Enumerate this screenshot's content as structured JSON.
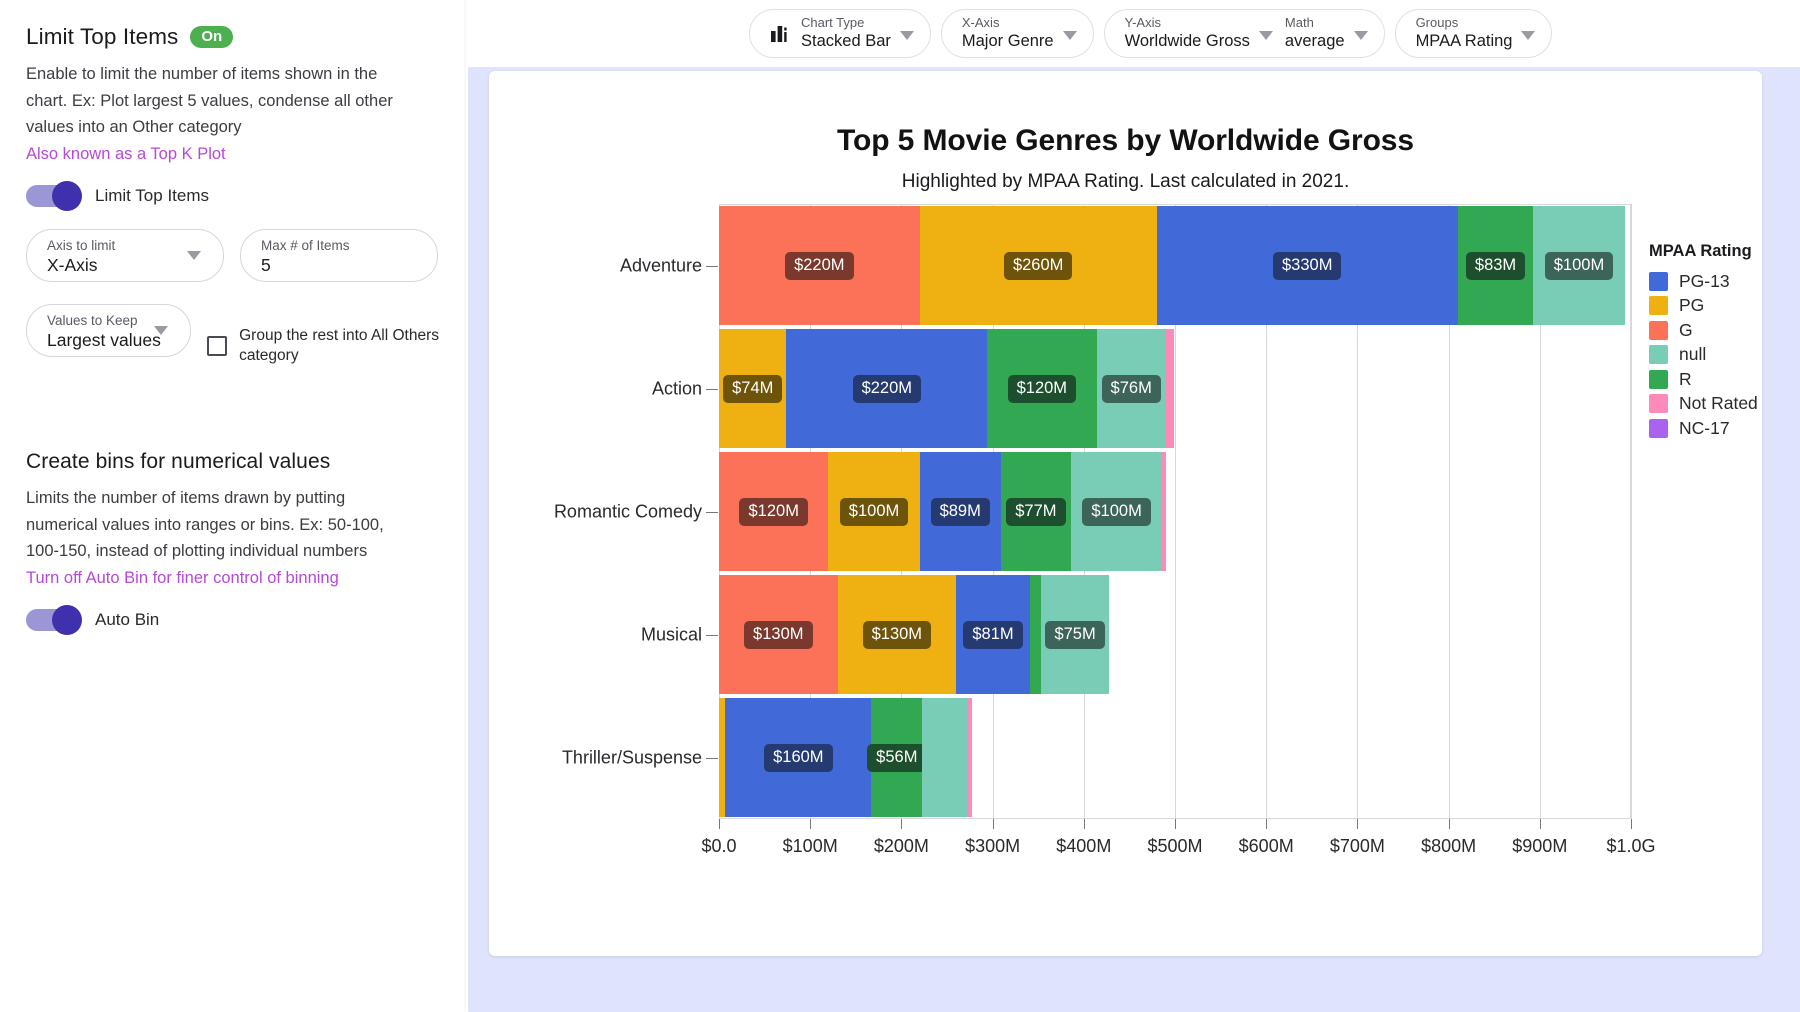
{
  "left_panel": {
    "section1": {
      "title": "Limit Top Items",
      "badge": "On",
      "description": "Enable to limit the number of items shown in the chart. Ex: Plot largest 5 values, condense all other values into an Other category",
      "link": "Also known as a Top K Plot",
      "toggle_label": "Limit Top Items",
      "fields": [
        {
          "label": "Axis to limit",
          "value": "X-Axis",
          "type": "select"
        },
        {
          "label": "Max # of Items",
          "value": "5",
          "type": "input"
        },
        {
          "label": "Values to Keep",
          "value": "Largest values",
          "type": "select"
        }
      ],
      "checkbox_label": "Group the rest into All Others category"
    },
    "section2": {
      "title": "Create bins for numerical values",
      "description": "Limits the number of items drawn by putting numerical values into ranges or bins. Ex: 50-100, 100-150, instead of plotting individual numbers",
      "link": "Turn off Auto Bin for finer control of binning",
      "toggle_label": "Auto Bin"
    }
  },
  "toolbar": {
    "controls": [
      {
        "label": "Chart Type",
        "value": "Stacked Bar",
        "icon": "bar-chart-icon"
      },
      {
        "label": "X-Axis",
        "value": "Major Genre"
      },
      {
        "label": "Y-Axis",
        "value": "Worldwide Gross"
      },
      {
        "label": "Math",
        "value": "average"
      },
      {
        "label": "Groups",
        "value": "MPAA Rating"
      }
    ]
  },
  "chart_data": {
    "type": "bar",
    "orientation": "horizontal",
    "stacked": true,
    "title": "Top 5 Movie Genres by Worldwide Gross",
    "subtitle": "Highlighted by MPAA Rating. Last calculated in 2021.",
    "xlabel": "",
    "ylabel": "",
    "grid": true,
    "legend_position": "right",
    "legend_title": "MPAA Rating",
    "xlim": [
      0,
      1000
    ],
    "xticks": [
      0,
      100,
      200,
      300,
      400,
      500,
      600,
      700,
      800,
      900,
      1000
    ],
    "xticklabels": [
      "$0.0",
      "$100M",
      "$200M",
      "$300M",
      "$400M",
      "$500M",
      "$600M",
      "$700M",
      "$800M",
      "$900M",
      "$1.0G"
    ],
    "categories": [
      "Adventure",
      "Action",
      "Romantic Comedy",
      "Musical",
      "Thriller/Suspense"
    ],
    "series": [
      {
        "name": "PG-13",
        "color": "#4169d8",
        "values": [
          330,
          220,
          89,
          81,
          160
        ]
      },
      {
        "name": "PG",
        "color": "#eeb111",
        "values": [
          260,
          74,
          100,
          130,
          7
        ]
      },
      {
        "name": "G",
        "color": "#fb7259",
        "values": [
          220,
          0,
          120,
          130,
          0
        ]
      },
      {
        "name": "null",
        "color": "#79ccb5",
        "values": [
          100,
          76,
          100,
          75,
          50
        ]
      },
      {
        "name": "R",
        "color": "#32a852",
        "values": [
          83,
          120,
          77,
          12,
          56
        ]
      },
      {
        "name": "Not Rated",
        "color": "#fd8ab8",
        "values": [
          0,
          9,
          4,
          0,
          5
        ]
      },
      {
        "name": "NC-17",
        "color": "#aa63ec",
        "values": [
          0,
          0,
          0,
          0,
          0
        ]
      }
    ],
    "stacks": [
      {
        "category": "Adventure",
        "segments": [
          {
            "rating": "G",
            "value": 220,
            "label": "$220M",
            "color": "#fb7259",
            "label_bg": "#7b392e"
          },
          {
            "rating": "PG",
            "value": 260,
            "label": "$260M",
            "color": "#eeb111",
            "label_bg": "#6e540b"
          },
          {
            "rating": "PG-13",
            "value": 330,
            "label": "$330M",
            "color": "#4169d8",
            "label_bg": "#243a70"
          },
          {
            "rating": "R",
            "value": 83,
            "label": "$83M",
            "color": "#32a852",
            "label_bg": "#1d4f2e"
          },
          {
            "rating": "null",
            "value": 100,
            "label": "$100M",
            "color": "#79ccb5",
            "label_bg": "#3c6459"
          }
        ]
      },
      {
        "category": "Action",
        "segments": [
          {
            "rating": "PG",
            "value": 74,
            "label": "$74M",
            "color": "#eeb111",
            "label_bg": "#6e540b"
          },
          {
            "rating": "PG-13",
            "value": 220,
            "label": "$220M",
            "color": "#4169d8",
            "label_bg": "#243a70"
          },
          {
            "rating": "R",
            "value": 120,
            "label": "$120M",
            "color": "#32a852",
            "label_bg": "#1d4f2e"
          },
          {
            "rating": "null",
            "value": 76,
            "label": "$76M",
            "color": "#79ccb5",
            "label_bg": "#3c6459"
          },
          {
            "rating": "Not Rated",
            "value": 9,
            "label": "",
            "color": "#fd8ab8",
            "label_bg": "#7b4159"
          }
        ]
      },
      {
        "category": "Romantic Comedy",
        "segments": [
          {
            "rating": "G",
            "value": 120,
            "label": "$120M",
            "color": "#fb7259",
            "label_bg": "#7b392e"
          },
          {
            "rating": "PG",
            "value": 100,
            "label": "$100M",
            "color": "#eeb111",
            "label_bg": "#6e540b"
          },
          {
            "rating": "PG-13",
            "value": 89,
            "label": "$89M",
            "color": "#4169d8",
            "label_bg": "#243a70"
          },
          {
            "rating": "R",
            "value": 77,
            "label": "$77M",
            "color": "#32a852",
            "label_bg": "#1d4f2e"
          },
          {
            "rating": "null",
            "value": 100,
            "label": "$100M",
            "color": "#79ccb5",
            "label_bg": "#3c6459"
          },
          {
            "rating": "Not Rated",
            "value": 4,
            "label": "",
            "color": "#fd8ab8",
            "label_bg": "#7b4159"
          }
        ]
      },
      {
        "category": "Musical",
        "segments": [
          {
            "rating": "G",
            "value": 130,
            "label": "$130M",
            "color": "#fb7259",
            "label_bg": "#7b392e"
          },
          {
            "rating": "PG",
            "value": 130,
            "label": "$130M",
            "color": "#eeb111",
            "label_bg": "#6e540b"
          },
          {
            "rating": "PG-13",
            "value": 81,
            "label": "$81M",
            "color": "#4169d8",
            "label_bg": "#243a70"
          },
          {
            "rating": "R",
            "value": 12,
            "label": "",
            "color": "#32a852",
            "label_bg": "#1d4f2e"
          },
          {
            "rating": "null",
            "value": 75,
            "label": "$75M",
            "color": "#79ccb5",
            "label_bg": "#3c6459"
          }
        ]
      },
      {
        "category": "Thriller/Suspense",
        "segments": [
          {
            "rating": "PG",
            "value": 7,
            "label": "",
            "color": "#eeb111",
            "label_bg": "#6e540b"
          },
          {
            "rating": "PG-13",
            "value": 160,
            "label": "$160M",
            "color": "#4169d8",
            "label_bg": "#243a70"
          },
          {
            "rating": "R",
            "value": 56,
            "label": "$56M",
            "color": "#32a852",
            "label_bg": "#1d4f2e"
          },
          {
            "rating": "null",
            "value": 50,
            "label": "",
            "color": "#79ccb5",
            "label_bg": "#3c6459"
          },
          {
            "rating": "Not Rated",
            "value": 5,
            "label": "",
            "color": "#fd8ab8",
            "label_bg": "#7b4159"
          }
        ]
      }
    ],
    "legend": [
      {
        "name": "PG-13",
        "color": "#4169d8"
      },
      {
        "name": "PG",
        "color": "#eeb111"
      },
      {
        "name": "G",
        "color": "#fb7259"
      },
      {
        "name": "null",
        "color": "#79ccb5"
      },
      {
        "name": "R",
        "color": "#32a852"
      },
      {
        "name": "Not Rated",
        "color": "#fd8ab8"
      },
      {
        "name": "NC-17",
        "color": "#aa63ec"
      }
    ]
  }
}
